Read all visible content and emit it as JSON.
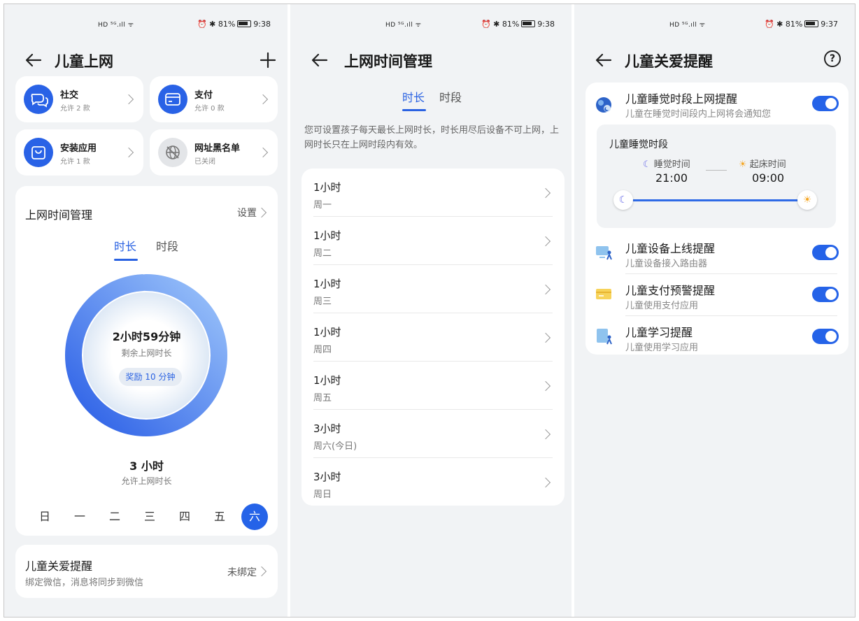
{
  "status_bars": [
    {
      "signal": "HD ⁵ᴳ.ıll ᯤ",
      "battery": "81%",
      "time": "9:38"
    },
    {
      "signal": "HD ⁵ᴳ.ıll ᯤ",
      "battery": "81%",
      "time": "9:38"
    },
    {
      "signal": "HD ⁵ᴳ.ıll ᯤ",
      "battery": "81%",
      "time": "9:37"
    }
  ],
  "screen1": {
    "title": "儿童上网",
    "tiles": [
      {
        "title": "社交",
        "sub": "允许 2 款",
        "icon": "chat-icon"
      },
      {
        "title": "支付",
        "sub": "允许 0 款",
        "icon": "wallet-icon"
      },
      {
        "title": "安装应用",
        "sub": "允许 1 款",
        "icon": "shopping-bag-icon"
      },
      {
        "title": "网址黑名单",
        "sub": "已关闭",
        "icon": "globe-blocked-icon"
      }
    ],
    "time_card": {
      "title": "上网时间管理",
      "action": "设置",
      "tabs": [
        "时长",
        "时段"
      ],
      "active_tab": 0,
      "ring_used_fraction": 0.99,
      "remaining": "2小时59分钟",
      "remaining_label": "剩余上网时长",
      "bonus": "奖励 10 分钟",
      "allowed": "3 小时",
      "allowed_label": "允许上网时长",
      "days": [
        "日",
        "一",
        "二",
        "三",
        "四",
        "五",
        "六"
      ],
      "selected_day": 6
    },
    "care_card": {
      "title": "儿童关爱提醒",
      "sub": "绑定微信，消息将同步到微信",
      "action": "未绑定"
    }
  },
  "screen2": {
    "title": "上网时间管理",
    "tabs": [
      "时长",
      "时段"
    ],
    "active_tab": 0,
    "description": "您可设置孩子每天最长上网时长，时长用尽后设备不可上网，上网时长只在上网时段内有效。",
    "rows": [
      {
        "value": "1小时",
        "day": "周一"
      },
      {
        "value": "1小时",
        "day": "周二"
      },
      {
        "value": "1小时",
        "day": "周三"
      },
      {
        "value": "1小时",
        "day": "周四"
      },
      {
        "value": "1小时",
        "day": "周五"
      },
      {
        "value": "3小时",
        "day": "周六(今日)"
      },
      {
        "value": "3小时",
        "day": "周日"
      }
    ]
  },
  "screen3": {
    "title": "儿童关爱提醒",
    "help": "?",
    "sleep": {
      "title": "儿童睡觉时段上网提醒",
      "sub": "儿童在睡觉时间段内上网将会通知您",
      "enabled": true,
      "box_title": "儿童睡觉时段",
      "bed_label": "睡觉时间",
      "bed_time": "21:00",
      "wake_label": "起床时间",
      "wake_time": "09:00"
    },
    "items": [
      {
        "title": "儿童设备上线提醒",
        "sub": "儿童设备接入路由器",
        "enabled": true,
        "icon": "device-online-icon"
      },
      {
        "title": "儿童支付预警提醒",
        "sub": "儿童使用支付应用",
        "enabled": true,
        "icon": "payment-warning-icon"
      },
      {
        "title": "儿童学习提醒",
        "sub": "儿童使用学习应用",
        "enabled": true,
        "icon": "study-icon"
      }
    ],
    "colors": {
      "accent": "#2563e8",
      "bg": "#f1f3f5"
    }
  }
}
